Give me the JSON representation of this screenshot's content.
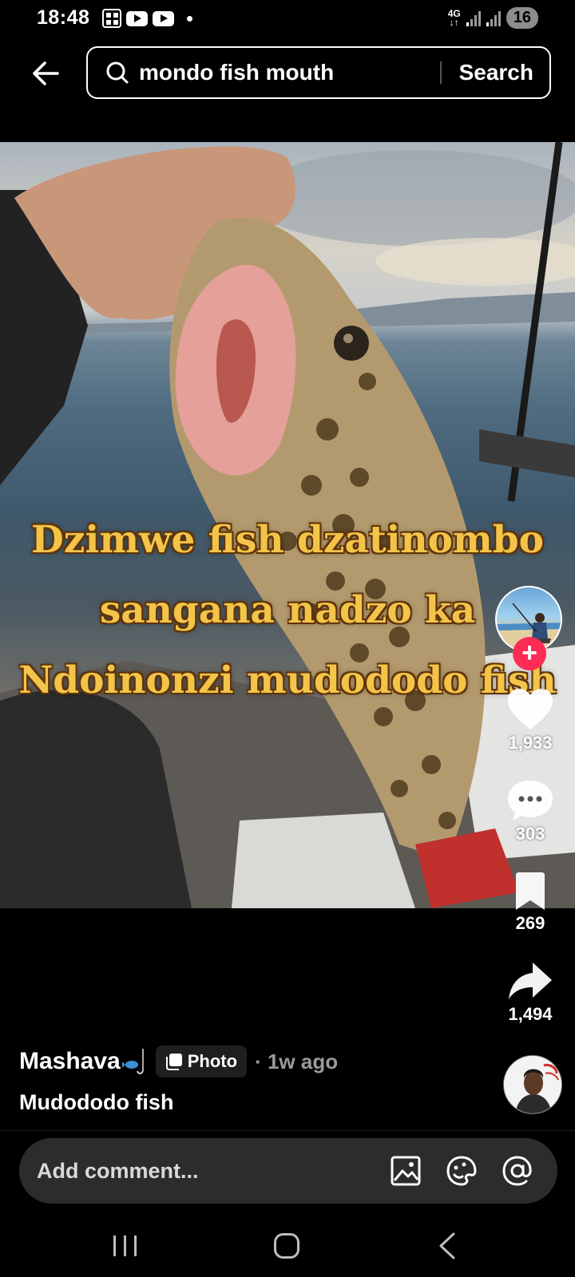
{
  "status_bar": {
    "time": "18:48",
    "network": "4G",
    "battery": "16"
  },
  "search": {
    "query": "mondo fish mouth",
    "button_label": "Search"
  },
  "post": {
    "caption_lines": [
      "Dzimwe fish dzatinombo",
      "sangana nadzo ka",
      "Ndoinonzi mudododo fish"
    ],
    "author": "Mashava",
    "type_badge": "Photo",
    "posted": "· 1w ago",
    "description": "Mudododo fish"
  },
  "actions": {
    "likes": "1,933",
    "comments": "303",
    "saves": "269",
    "shares": "1,494"
  },
  "comment_bar": {
    "placeholder": "Add comment..."
  },
  "colors": {
    "follow_accent": "#fe2c55",
    "caption_text": "#f2c44a"
  },
  "icons": [
    "back-arrow-icon",
    "search-icon",
    "heart-icon",
    "comment-icon",
    "bookmark-icon",
    "share-icon",
    "image-icon",
    "emoji-icon",
    "mention-icon",
    "recents-icon",
    "home-icon",
    "nav-back-icon"
  ]
}
